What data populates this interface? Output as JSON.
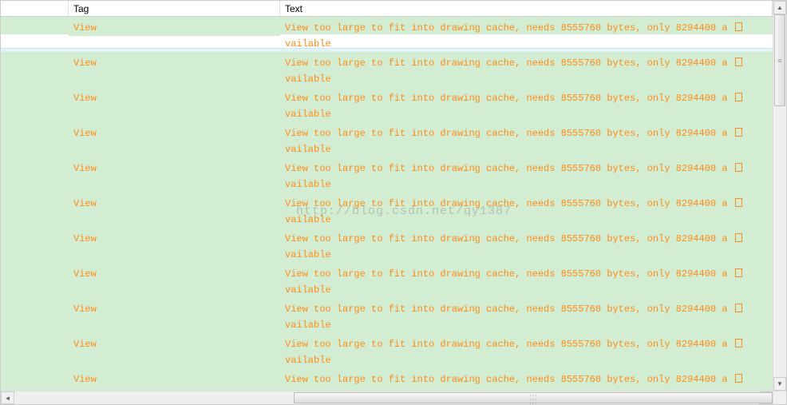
{
  "columns": {
    "tag": "Tag",
    "text": "Text"
  },
  "watermark": "http://blog.csdn.net/qy1387",
  "log_message_part1": "View too large to fit into drawing cache, needs 8555760 bytes, only 8294400 a ",
  "log_message_part2": "vailable",
  "rows": [
    {
      "tag": "View"
    },
    {
      "tag": "View"
    },
    {
      "tag": "View"
    },
    {
      "tag": "View"
    },
    {
      "tag": "View"
    },
    {
      "tag": "View"
    },
    {
      "tag": "View"
    },
    {
      "tag": "View"
    },
    {
      "tag": "View"
    },
    {
      "tag": "View"
    },
    {
      "tag": "View"
    }
  ]
}
